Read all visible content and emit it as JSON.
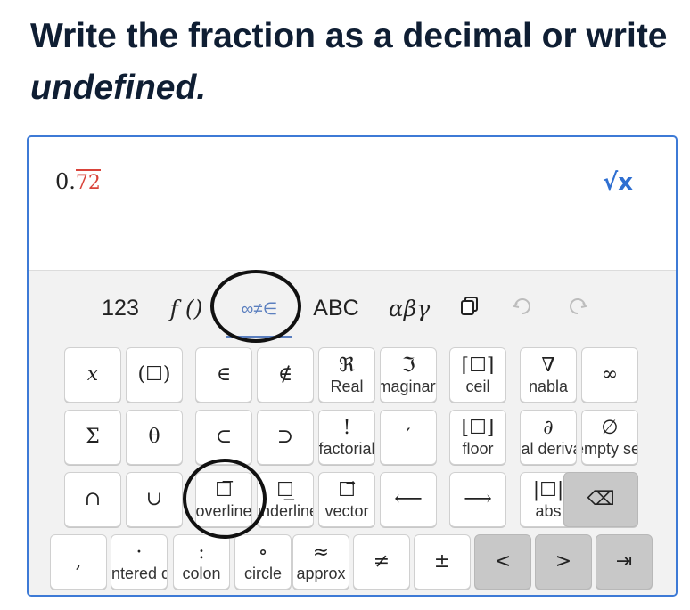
{
  "prompt": {
    "line1": "Write the fraction as a decimal or write",
    "line2": "undefined."
  },
  "answer": {
    "integer_part": "0.",
    "repeating_part": "72"
  },
  "editor": {
    "sqrt_icon": "√x"
  },
  "tabs": [
    {
      "label": "123"
    },
    {
      "label": "f ()"
    },
    {
      "label": "∞≠∈",
      "selected": true
    },
    {
      "label": "ABC"
    },
    {
      "label": "αβγ"
    }
  ],
  "tools": {
    "copy_icon": "copy-icon",
    "undo_icon": "undo-icon",
    "redo_icon": "redo-icon"
  },
  "keys": {
    "row1": [
      {
        "sym": "𝑥",
        "label": ""
      },
      {
        "sym": "(☐)",
        "label": ""
      },
      {
        "sym": "∈",
        "label": ""
      },
      {
        "sym": "∉",
        "label": ""
      },
      {
        "sym": "ℜ",
        "label": "Real"
      },
      {
        "sym": "ℑ",
        "label": "Imaginary"
      },
      {
        "sym": "⌈☐⌉",
        "label": "ceil"
      },
      {
        "sym": "∇",
        "label": "nabla"
      },
      {
        "sym": "∞",
        "label": ""
      }
    ],
    "row2": [
      {
        "sym": "Σ",
        "label": ""
      },
      {
        "sym": "θ",
        "label": ""
      },
      {
        "sym": "⊂",
        "label": ""
      },
      {
        "sym": "⊃",
        "label": ""
      },
      {
        "sym": "!",
        "label": "factorial"
      },
      {
        "sym": "′",
        "label": ""
      },
      {
        "sym": "⌊☐⌋",
        "label": "floor"
      },
      {
        "sym": "∂",
        "label": "partial derivative"
      },
      {
        "sym": "∅",
        "label": "empty set"
      }
    ],
    "row3": [
      {
        "sym": "∩",
        "label": ""
      },
      {
        "sym": "∪",
        "label": ""
      },
      {
        "sym": "☐̅",
        "label": "overline"
      },
      {
        "sym": "☐̲",
        "label": "underline"
      },
      {
        "sym": "☐⃗",
        "label": "vector"
      },
      {
        "sym": "⟵",
        "label": ""
      },
      {
        "sym": "⟶",
        "label": ""
      },
      {
        "sym": "|☐|",
        "label": "abs"
      },
      {
        "sym": "⌫",
        "label": ""
      }
    ],
    "row4": [
      {
        "sym": ",",
        "label": ""
      },
      {
        "sym": "·",
        "label": "centered dot"
      },
      {
        "sym": ":",
        "label": "colon"
      },
      {
        "sym": "∘",
        "label": "circle"
      },
      {
        "sym": "≈",
        "label": "approx"
      },
      {
        "sym": "≠",
        "label": ""
      },
      {
        "sym": "±",
        "label": ""
      },
      {
        "sym": "<",
        "label": ""
      },
      {
        "sym": ">",
        "label": ""
      },
      {
        "sym": "⇥",
        "label": ""
      }
    ]
  },
  "colors": {
    "accent": "#3d7ad6",
    "repeating_digits": "#d9433a",
    "selected_tab": "#5b7fbf"
  }
}
